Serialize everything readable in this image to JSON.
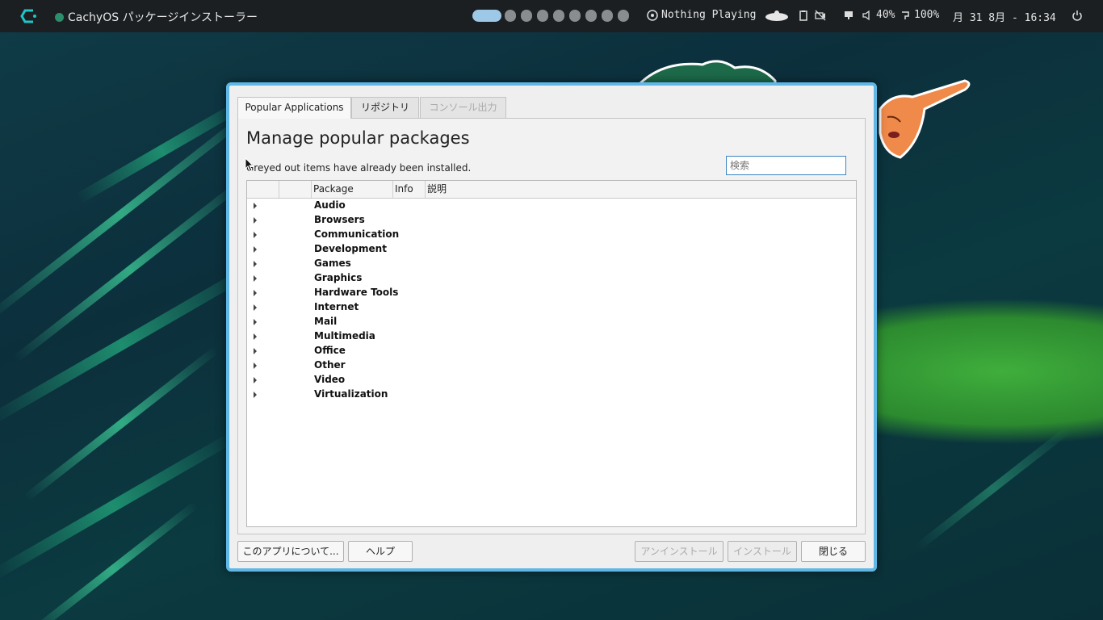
{
  "topbar": {
    "app_name": "CachyOS パッケージインストーラー",
    "media": "Nothing Playing",
    "volume": "40%",
    "battery": "100%",
    "datetime": "月 31  8月 - 16:34",
    "workspaces_total": 9,
    "workspace_active": 1,
    "accent_color": "#9ec8e8"
  },
  "dialog": {
    "tabs": [
      {
        "label": "Popular Applications",
        "state": "active"
      },
      {
        "label": "リポジトリ",
        "state": "normal"
      },
      {
        "label": "コンソール出力",
        "state": "disabled"
      }
    ],
    "heading": "Manage popular packages",
    "subtext": "Greyed out items have already been installed.",
    "search_placeholder": "検索",
    "columns": [
      "",
      "",
      "Package",
      "Info",
      "説明"
    ],
    "categories": [
      "Audio",
      "Browsers",
      "Communication",
      "Development",
      "Games",
      "Graphics",
      "Hardware Tools",
      "Internet",
      "Mail",
      "Multimedia",
      "Office",
      "Other",
      "Video",
      "Virtualization"
    ],
    "buttons": {
      "about": "このアプリについて...",
      "help": "ヘルプ",
      "uninstall": "アンインストール",
      "install": "インストール",
      "close": "閉じる"
    },
    "border_color": "#5fb7e6"
  }
}
